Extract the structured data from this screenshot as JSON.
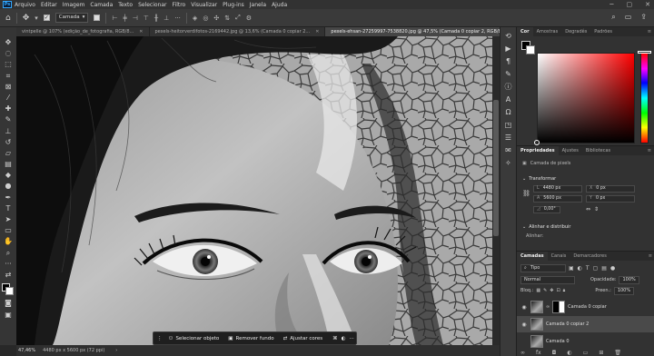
{
  "app": {
    "logo": "Ps"
  },
  "menu": [
    "Arquivo",
    "Editar",
    "Imagem",
    "Camada",
    "Texto",
    "Selecionar",
    "Filtro",
    "Visualizar",
    "Plug-ins",
    "Janela",
    "Ajuda"
  ],
  "window_controls": {
    "minimize": "─",
    "maximize": "▢",
    "close": "✕"
  },
  "options_bar": {
    "auto_select_target": "Camada",
    "icons": [
      "home-icon",
      "move-icon",
      "auto-select-checkbox",
      "align-icons",
      "distribute-icons",
      "more-icon",
      "3d-icon"
    ],
    "right_icons": [
      "search-icon",
      "workspace-icon",
      "share-icon"
    ]
  },
  "tabs": [
    {
      "label": "vintpelle @ 107% (edição_de_fotografia, RGB/8...",
      "active": false
    },
    {
      "label": "pexels-heitorverdifotos-2169442.jpg @ 13,6% (Camada 0 copiar 2...",
      "active": false
    },
    {
      "label": "pexels-ehsan-27259997-7538820.jpg @ 47,5% (Camada 0 copiar 2, RGB/8) *",
      "active": true
    }
  ],
  "tools": [
    "move-tool",
    "artboard-tool",
    "marquee-tool",
    "lasso-tool",
    "object-select-tool",
    "crop-tool",
    "frame-tool",
    "eyedropper-tool",
    "healing-tool",
    "brush-tool",
    "stamp-tool",
    "history-brush-tool",
    "eraser-tool",
    "gradient-tool",
    "blur-tool",
    "dodge-tool",
    "pen-tool",
    "type-tool",
    "path-select-tool",
    "shape-tool",
    "hand-tool",
    "zoom-tool",
    "more-tools"
  ],
  "taskbar": {
    "select_object": "Selecionar objeto",
    "remove_background": "Remover fundo",
    "adjust_colors": "Ajustar cores"
  },
  "status": {
    "zoom": "47,46%",
    "doc_size": "4480 px x 5600 px (72 ppi)"
  },
  "color_panel": {
    "tabs": [
      "Cor",
      "Amostras",
      "Degradês",
      "Padrões"
    ],
    "foreground": "#000000",
    "background": "#ffffff",
    "hue": "#ff0000"
  },
  "properties_panel": {
    "tabs": [
      "Propriedades",
      "Ajustes",
      "Bibliotecas"
    ],
    "layer_kind": "Camada de pixels",
    "transform_header": "Transformar",
    "w_label": "L",
    "w_value": "4480 px",
    "h_label": "A",
    "h_value": "5600 px",
    "x_label": "X",
    "x_value": "0 px",
    "y_label": "Y",
    "y_value": "0 px",
    "angle_value": "0,00°",
    "align_header": "Alinhar e distribuir",
    "align_label": "Alinhar:"
  },
  "layers_panel": {
    "tabs": [
      "Camadas",
      "Canais",
      "Demarcadores"
    ],
    "filter_kind": "Tipo",
    "blend_mode": "Normal",
    "opacity_label": "Opacidade:",
    "opacity_value": "100%",
    "lock_label": "Bloq.:",
    "fill_label": "Preen.:",
    "fill_value": "100%",
    "layers": [
      {
        "name": "Camada 0 copiar",
        "visible": true,
        "has_mask": true,
        "selected": false
      },
      {
        "name": "Camada 0 copiar 2",
        "visible": true,
        "has_mask": false,
        "selected": true
      },
      {
        "name": "Camada 0",
        "visible": false,
        "has_mask": false,
        "selected": false
      }
    ]
  }
}
